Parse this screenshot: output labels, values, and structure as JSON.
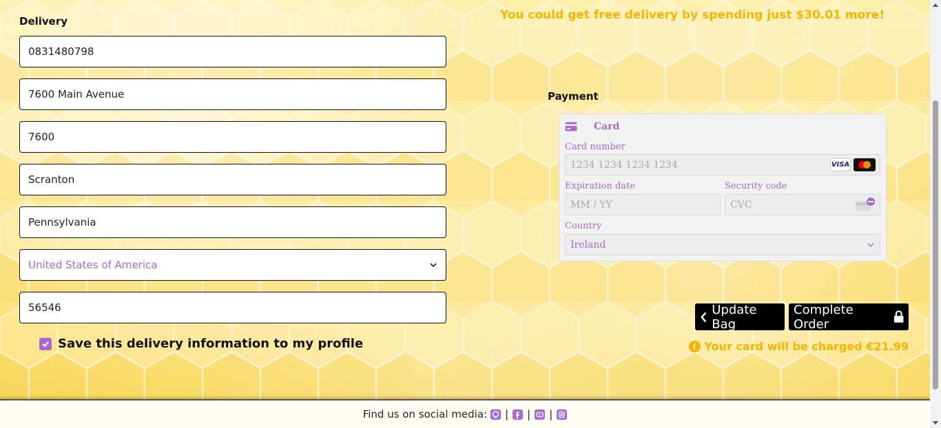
{
  "delivery": {
    "heading": "Delivery",
    "phone": "0831480798",
    "street1": "7600 Main Avenue",
    "street2": "7600",
    "town": "Scranton",
    "county": "Pennsylvania",
    "country": "United States of America",
    "postcode": "56546",
    "save_label": "Save this delivery information to my profile",
    "save_checked": true
  },
  "free_delivery_msg": "You could get free delivery by spending just $30.01 more!",
  "payment": {
    "heading": "Payment",
    "tab_label": "Card",
    "card_number_label": "Card number",
    "card_number_placeholder": "1234 1234 1234 1234",
    "brands": [
      "VISA",
      "mastercard"
    ],
    "expiry_label": "Expiration date",
    "expiry_placeholder": "MM / YY",
    "cvc_label": "Security code",
    "cvc_placeholder": "CVC",
    "country_label": "Country",
    "country_value": "Ireland"
  },
  "buttons": {
    "update_bag": "Update Bag",
    "complete_order": "Complete Order"
  },
  "charge_msg": "Your card will be charged €21.99",
  "footer": {
    "text": "Find us on social media:",
    "separator": "|",
    "icons": [
      "github-icon",
      "facebook-icon",
      "youtube-icon",
      "instagram-icon"
    ]
  },
  "colors": {
    "accent_purple": "#a869d2",
    "accent_gold": "#f7b500",
    "button_bg": "#000000"
  }
}
